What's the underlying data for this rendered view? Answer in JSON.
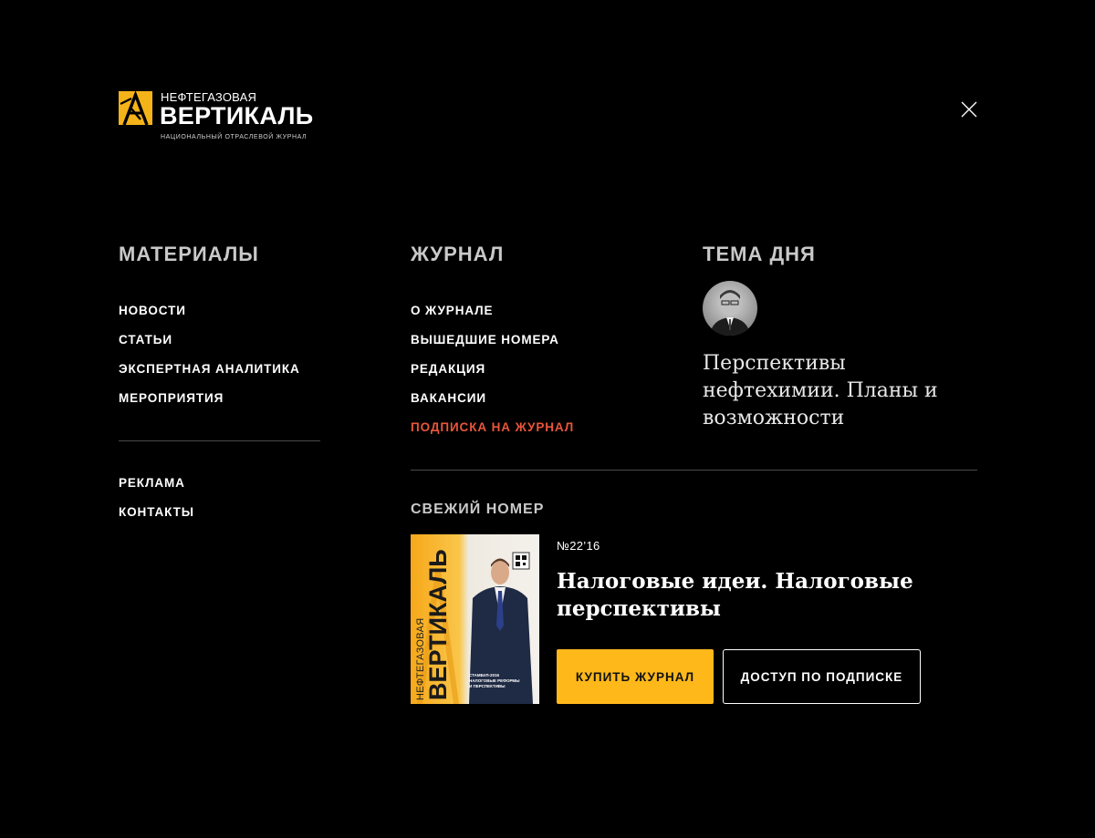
{
  "logo": {
    "top": "НЕФТЕГАЗОВАЯ",
    "main": "ВЕРТИКАЛЬ",
    "sub": "НАЦИОНАЛЬНЫЙ ОТРАСЛЕВОЙ ЖУРНАЛ",
    "color": "#f5b31a"
  },
  "columns": {
    "materials": {
      "title": "МАТЕРИАЛЫ",
      "items": [
        "НОВОСТИ",
        "СТАТЬИ",
        "ЭКСПЕРТНАЯ АНАЛИТИКА",
        "МЕРОПРИЯТИЯ"
      ],
      "extra": [
        "РЕКЛАМА",
        "КОНТАКТЫ"
      ]
    },
    "journal": {
      "title": "ЖУРНАЛ",
      "items": [
        "О ЖУРНАЛЕ",
        "ВЫШЕДШИЕ НОМЕРА",
        "РЕДАКЦИЯ",
        "ВАКАНСИИ",
        "ПОДПИСКА НА ЖУРНАЛ"
      ]
    },
    "topic": {
      "title": "ТЕМА ДНЯ",
      "text": "Перспективы нефтехимии. Планы и возможности"
    }
  },
  "fresh": {
    "title": "СВЕЖИЙ НОМЕР",
    "issue": "№22’16",
    "issue_title": "Налоговые идеи. Налоговые перспективы",
    "buy_label": "КУПИТЬ ЖУРНАЛ",
    "subscribe_label": "ДОСТУП ПО ПОДПИСКЕ",
    "cover": {
      "top": "НЕФТЕГАЗОВАЯ",
      "main": "ВЕРТИКАЛЬ",
      "blurb": "СТАМБУЛ-2016 НАЛОГОВЫЕ РЕФОРМЫ И ПЕРСПЕКТИВЫ"
    }
  },
  "colors": {
    "accent": "#e8563a",
    "buy_button": "#ffb81a",
    "background": "#000000"
  },
  "icons": {
    "close": "close-icon",
    "logo_mark": "derrick-logo-icon"
  }
}
